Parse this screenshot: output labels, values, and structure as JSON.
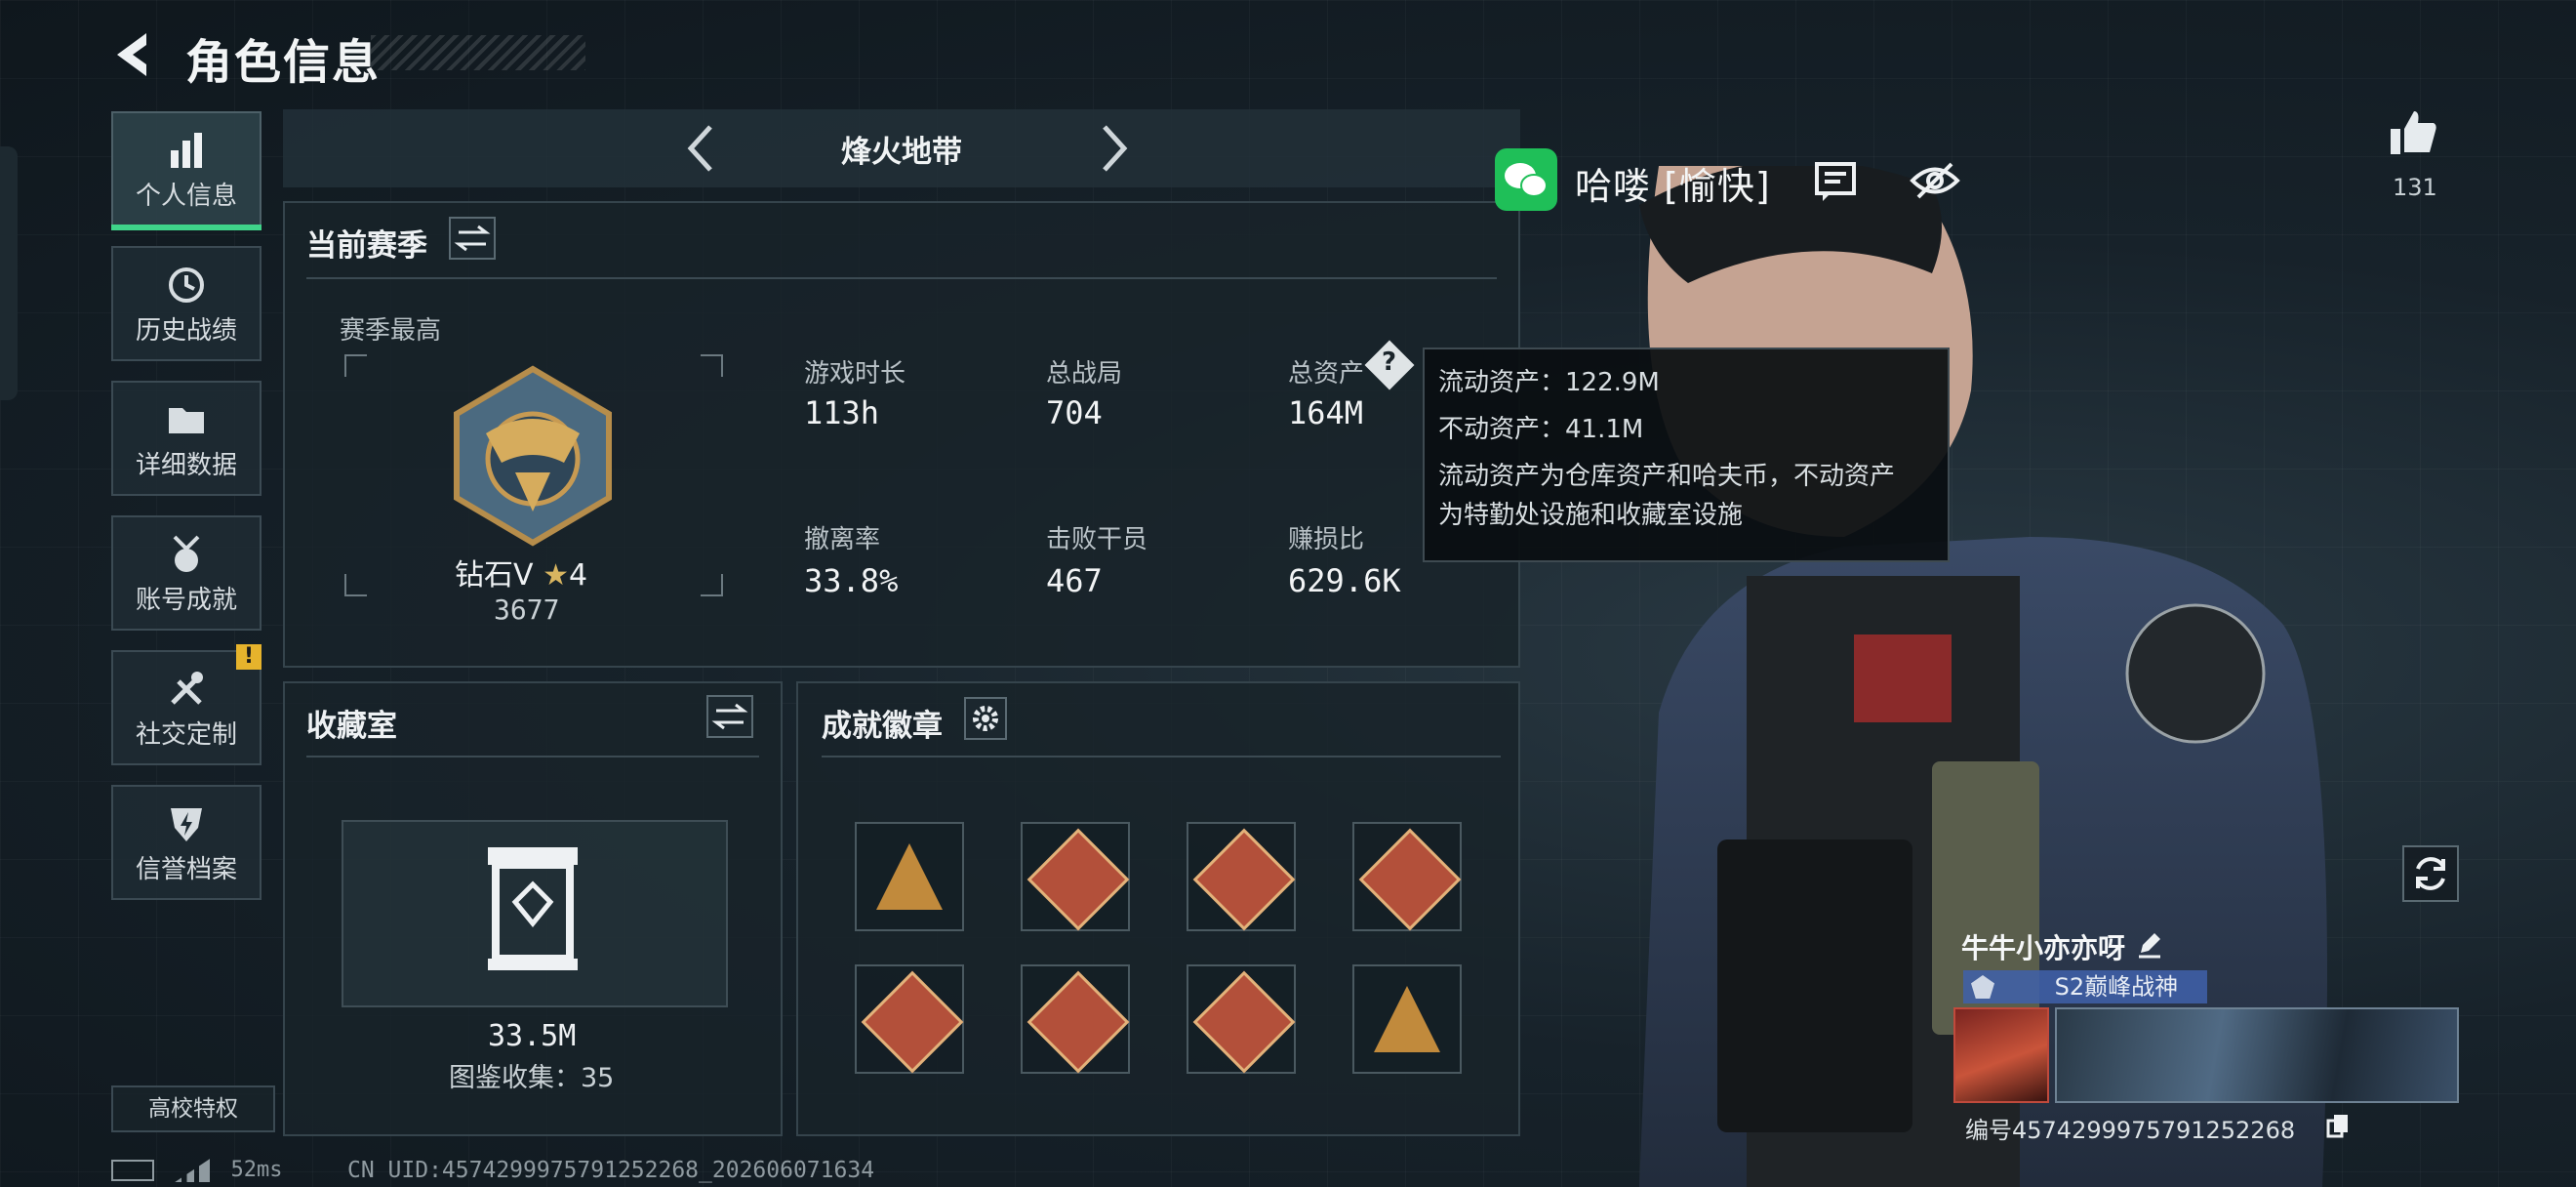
{
  "header": {
    "title": "角色信息"
  },
  "nav": {
    "items": [
      {
        "label": "个人信息",
        "icon": "bar-chart-icon",
        "active": true
      },
      {
        "label": "历史战绩",
        "icon": "history-clock-icon",
        "active": false
      },
      {
        "label": "详细数据",
        "icon": "folder-icon",
        "active": false
      },
      {
        "label": "账号成就",
        "icon": "medal-icon",
        "active": false
      },
      {
        "label": "社交定制",
        "icon": "tools-icon",
        "active": false,
        "alert": "!"
      },
      {
        "label": "信誉档案",
        "icon": "shield-bolt-icon",
        "active": false
      }
    ],
    "college_label": "高校特权"
  },
  "mode": {
    "name": "烽火地带"
  },
  "season": {
    "title": "当前赛季",
    "best_label": "赛季最高",
    "rank_name": "钻石V",
    "rank_stars": "4",
    "rank_score": "3677",
    "stats": [
      {
        "label": "游戏时长",
        "value": "113h"
      },
      {
        "label": "总战局",
        "value": "704"
      },
      {
        "label": "总资产",
        "value": "164M",
        "help": "?"
      },
      {
        "label": "撤离率",
        "value": "33.8%"
      },
      {
        "label": "击败干员",
        "value": "467"
      },
      {
        "label": "赚损比",
        "value": "629.6K"
      }
    ]
  },
  "tooltip": {
    "liquid": "流动资产：122.9M",
    "fixed": "不动资产：41.1M",
    "desc_line1": "流动资产为仓库资产和哈夫币，不动资产",
    "desc_line2": "为特勤处设施和收藏室设施"
  },
  "collection": {
    "title": "收藏室",
    "value": "33.5M",
    "catalog": "图鉴收集：35"
  },
  "badges": {
    "title": "成就徽章",
    "items": [
      "triangle-badge-icon",
      "wolf-badge-icon",
      "wolf-badge-icon",
      "runner-badge-icon",
      "dragon-badge-icon",
      "dragon-badge-icon",
      "runner-badge-icon",
      "pyramid-badge-icon"
    ]
  },
  "player": {
    "status": "哈喽 [愉快]",
    "likes": "131",
    "name": "牛牛小亦亦呀",
    "tag": "S2巅峰战神",
    "id_text": "编号4574299975791252268"
  },
  "footer": {
    "ping": "52ms",
    "uid": "CN UID:4574299975791252268_202606071634"
  },
  "colors": {
    "accent_green": "#3fd48a",
    "alert_yellow": "#e6b32c",
    "wechat_green": "#1fbf58",
    "tag_blue": "#4060aa"
  }
}
